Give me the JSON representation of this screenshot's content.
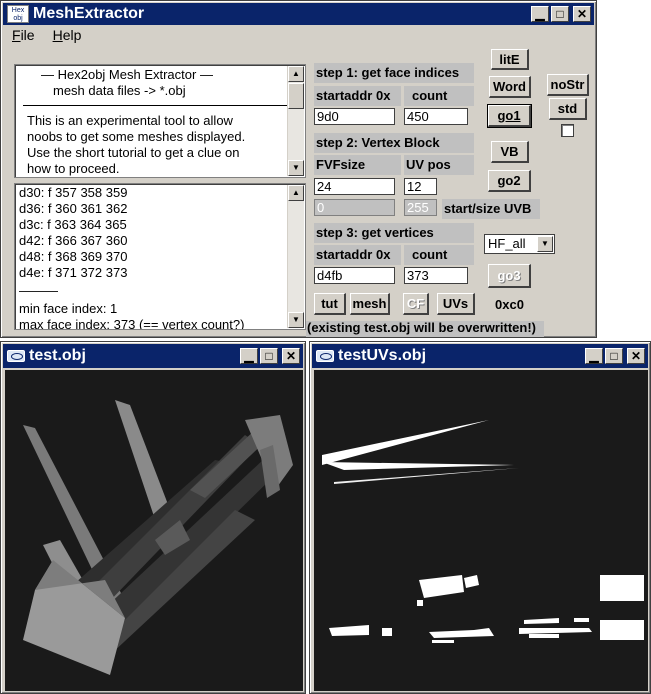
{
  "main_window": {
    "title": "MeshExtractor",
    "icon_text_top": "Hex",
    "icon_text_bottom": "obj",
    "menu": [
      {
        "label_ul": "F",
        "label_rest": "ile"
      },
      {
        "label_ul": "H",
        "label_rest": "elp"
      }
    ],
    "info_text": {
      "line1": "—   Hex2obj Mesh Extractor   —",
      "line2": "mesh data files -> *.obj",
      "para": [
        "This is an experimental tool to allow",
        "noobs to get some meshes displayed.",
        "Use the short tutorial to get a clue on",
        "how to proceed."
      ]
    },
    "face_log": {
      "lines": [
        "d30: f  357 358 359",
        "d36: f  360 361 362",
        "d3c: f  363 364 365",
        "d42: f  366 367 360",
        "d48: f  368 369 370",
        "d4e: f  371 372 373"
      ],
      "separator": "———",
      "min_line": "min face index: 1",
      "max_line": "max face index: 373 (== vertex count?)"
    },
    "step1": {
      "title": "step 1: get face indices",
      "addr_label": "startaddr 0x",
      "count_label": "count",
      "addr_value": "9d0",
      "count_value": "450"
    },
    "step2": {
      "title": "step 2: Vertex Block",
      "fvf_label": "FVFsize",
      "uv_label": "UV pos",
      "fvf_value": "24",
      "uv_value": "12",
      "uvb_start": "0",
      "uvb_size": "255",
      "uvb_label": "start/size UVB"
    },
    "step3": {
      "title": "step 3: get vertices",
      "addr_label": "startaddr 0x",
      "count_label": "count",
      "addr_value": "d4fb",
      "count_value": "373"
    },
    "buttons": {
      "lite": "litE",
      "word": "Word",
      "go1": "go1",
      "vb": "VB",
      "go2": "go2",
      "go3": "go3",
      "nostr": "noStr",
      "std": "std",
      "tut": "tut",
      "mesh": "mesh",
      "cf": "CF",
      "uvs": "UVs"
    },
    "format_select": "HF_all",
    "status_code": "0xc0",
    "warning": "(existing test.obj will be overwritten!)"
  },
  "mesh_window": {
    "title": "test.obj"
  },
  "uv_window": {
    "title": "testUVs.obj"
  },
  "colors": {
    "title_active": "#0a246a",
    "face": "#d4d0c8",
    "canvas_bg": "#1a1a1a"
  }
}
